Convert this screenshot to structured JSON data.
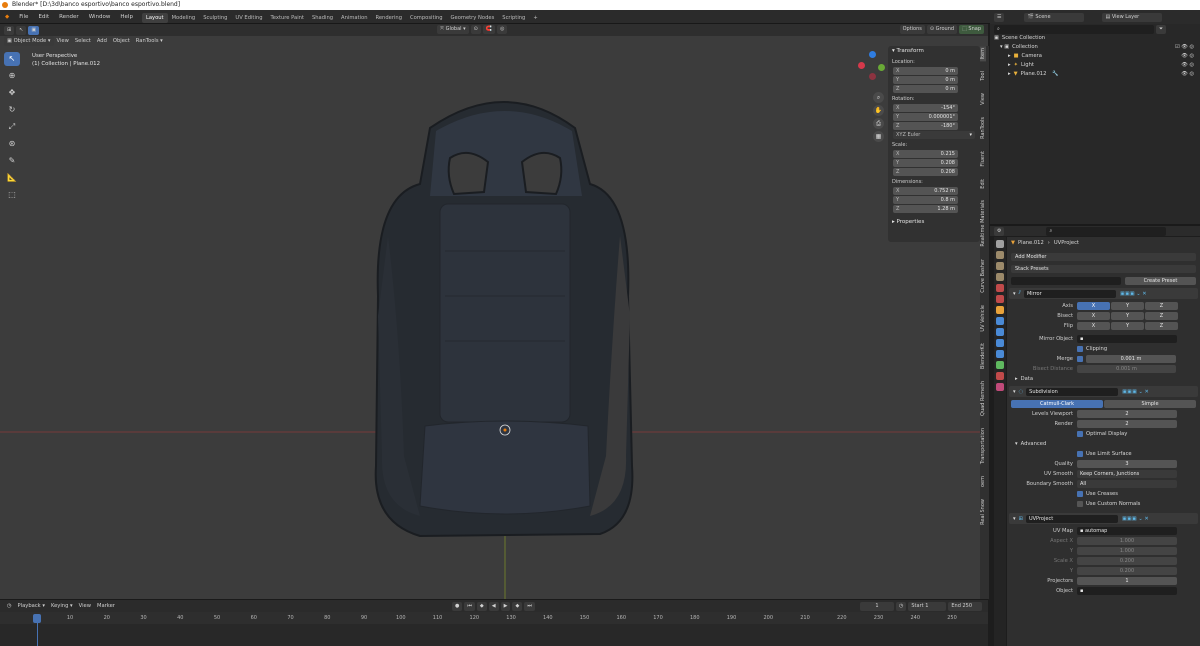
{
  "window": {
    "title": "Blender* [D:\\3d\\banco esportivo\\banco esportivo.blend]"
  },
  "menu": [
    "File",
    "Edit",
    "Render",
    "Window",
    "Help"
  ],
  "workspaces": [
    {
      "label": "Layout",
      "active": true
    },
    {
      "label": "Modeling"
    },
    {
      "label": "Sculpting"
    },
    {
      "label": "UV Editing"
    },
    {
      "label": "Texture Paint"
    },
    {
      "label": "Shading"
    },
    {
      "label": "Animation"
    },
    {
      "label": "Rendering"
    },
    {
      "label": "Compositing"
    },
    {
      "label": "Geometry Nodes"
    },
    {
      "label": "Scripting"
    }
  ],
  "viewport_header": {
    "mode": "Object Mode",
    "menus": [
      "View",
      "Select",
      "Add",
      "Object",
      "RanTools"
    ],
    "orientation": "Global",
    "options": "Options",
    "snap_target": "Ground",
    "snap": "Snap"
  },
  "viewport": {
    "perspective": "User Perspective",
    "collection": "(1) Collection | Plane.012"
  },
  "npanel": {
    "title": "Transform",
    "location_label": "Location:",
    "location": [
      {
        "axis": "X",
        "value": "0 m"
      },
      {
        "axis": "Y",
        "value": "0 m"
      },
      {
        "axis": "Z",
        "value": "0 m"
      }
    ],
    "rotation_label": "Rotation:",
    "rotation": [
      {
        "axis": "X",
        "value": "-154°"
      },
      {
        "axis": "Y",
        "value": "0.000001°"
      },
      {
        "axis": "Z",
        "value": "-180°"
      }
    ],
    "rotation_mode": "XYZ Euler",
    "scale_label": "Scale:",
    "scale": [
      {
        "axis": "X",
        "value": "0.215"
      },
      {
        "axis": "Y",
        "value": "0.208"
      },
      {
        "axis": "Z",
        "value": "0.208"
      }
    ],
    "dimensions_label": "Dimensions:",
    "dimensions": [
      {
        "axis": "X",
        "value": "0.752 m"
      },
      {
        "axis": "Y",
        "value": "0.8 m"
      },
      {
        "axis": "Z",
        "value": "1.28 m"
      }
    ],
    "properties": "Properties"
  },
  "side_tabs": [
    "Item",
    "Tool",
    "View",
    "RanTools",
    "Fluent",
    "Edit",
    "Realtime Materials",
    "Curve Basher",
    "UV Vehicle",
    "BlenderKit",
    "Quad Remesh",
    "Transportation",
    "oem",
    "Real Snow"
  ],
  "timeline": {
    "menus": [
      "Playback",
      "Keying",
      "View",
      "Marker"
    ],
    "current_frame": "1",
    "start_label": "Start",
    "start": "1",
    "end_label": "End",
    "end": "250",
    "ticks": [
      "1",
      "10",
      "20",
      "30",
      "40",
      "50",
      "60",
      "70",
      "80",
      "90",
      "100",
      "110",
      "120",
      "130",
      "140",
      "150",
      "160",
      "170",
      "180",
      "190",
      "200",
      "210",
      "220",
      "230",
      "240",
      "250"
    ]
  },
  "outliner": {
    "scene": "Scene",
    "view_layer": "View Layer",
    "root": "Scene Collection",
    "items": [
      {
        "label": "Collection",
        "level": 1
      },
      {
        "label": "Camera",
        "level": 2
      },
      {
        "label": "Light",
        "level": 2
      },
      {
        "label": "Plane.012",
        "level": 2,
        "selected": true
      }
    ]
  },
  "properties": {
    "object": "Plane.012",
    "modifier_name": "UVProject",
    "add_modifier": "Add Modifier",
    "stack_presets": "Stack Presets",
    "create_preset": "Create Preset",
    "mirror": {
      "name": "Mirror",
      "axis_label": "Axis",
      "bisect_label": "Bisect",
      "flip_label": "Flip",
      "axes": [
        "X",
        "Y",
        "Z"
      ],
      "mirror_object_label": "Mirror Object",
      "clipping": "Clipping",
      "merge_label": "Merge",
      "merge_value": "0.001 m",
      "bisect_distance_label": "Bisect Distance",
      "bisect_distance": "0.001 m",
      "data": "Data"
    },
    "subdivision": {
      "name": "Subdivision",
      "catmull": "Catmull-Clark",
      "simple": "Simple",
      "levels_viewport_label": "Levels Viewport",
      "levels_viewport": "2",
      "render_label": "Render",
      "render": "2",
      "optimal_display": "Optimal Display",
      "advanced": "Advanced",
      "use_limit_surface": "Use Limit Surface",
      "quality_label": "Quality",
      "quality": "3",
      "uv_smooth_label": "UV Smooth",
      "uv_smooth": "Keep Corners, Junctions",
      "boundary_smooth_label": "Boundary Smooth",
      "boundary_smooth": "All",
      "use_creases": "Use Creases",
      "use_custom_normals": "Use Custom Normals"
    },
    "uvproject": {
      "name": "UVProject",
      "uv_map_label": "UV Map",
      "uv_map": "automap",
      "aspect_x_label": "Aspect X",
      "aspect_x": "1.000",
      "aspect_y_label": "Y",
      "aspect_y": "1.000",
      "scale_x_label": "Scale X",
      "scale_x": "0.200",
      "scale_y_label": "Y",
      "scale_y": "0.200",
      "projectors_label": "Projectors",
      "projectors": "1",
      "object_label": "Object"
    }
  },
  "colors": {
    "accent": "#4772b3",
    "viewport_bg": "#3c3c3c",
    "origin": "#e87d0d"
  }
}
